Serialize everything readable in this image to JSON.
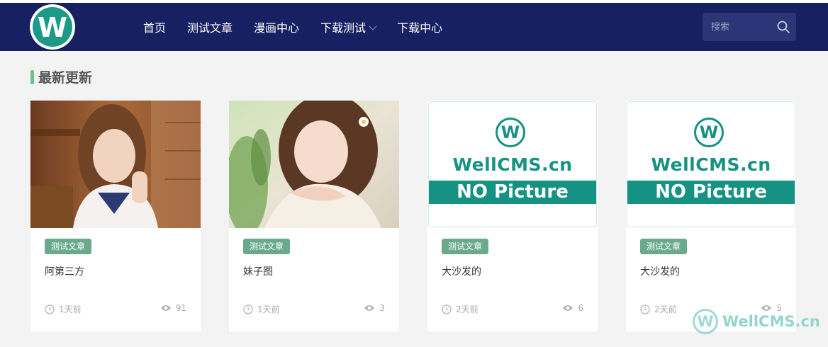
{
  "brand": {
    "logo_letter": "W",
    "logo_color": "#1d9a87"
  },
  "nav": {
    "items": [
      {
        "label": "首页"
      },
      {
        "label": "测试文章"
      },
      {
        "label": "漫画中心"
      },
      {
        "label": "下载测试",
        "has_dropdown": true
      },
      {
        "label": "下载中心"
      }
    ]
  },
  "search": {
    "placeholder": "搜索",
    "icon": "search-icon"
  },
  "section": {
    "title": "最新更新",
    "accent_color": "#6fc18b"
  },
  "cards": [
    {
      "thumbnail": "photo",
      "badge": "测试文章",
      "title": "阿第三方",
      "time": "1天前",
      "views": "91"
    },
    {
      "thumbnail": "photo",
      "badge": "测试文章",
      "title": "妹子图",
      "time": "1天前",
      "views": "3"
    },
    {
      "thumbnail": "no-picture",
      "thumb_logo_letter": "W",
      "thumb_brand": "WellCMS.cn",
      "thumb_label": "NO Picture",
      "badge": "测试文章",
      "title": "大沙发的",
      "time": "2天前",
      "views": "6"
    },
    {
      "thumbnail": "no-picture",
      "thumb_logo_letter": "W",
      "thumb_brand": "WellCMS.cn",
      "thumb_label": "NO Picture",
      "badge": "测试文章",
      "title": "大沙发的",
      "time": "2天前",
      "views": "5"
    }
  ],
  "watermark": {
    "letter": "W",
    "text": "WellCMS.cn"
  },
  "colors": {
    "navbar_bg": "#172061",
    "badge_bg": "#6aaa8c",
    "brand_teal": "#159282"
  }
}
